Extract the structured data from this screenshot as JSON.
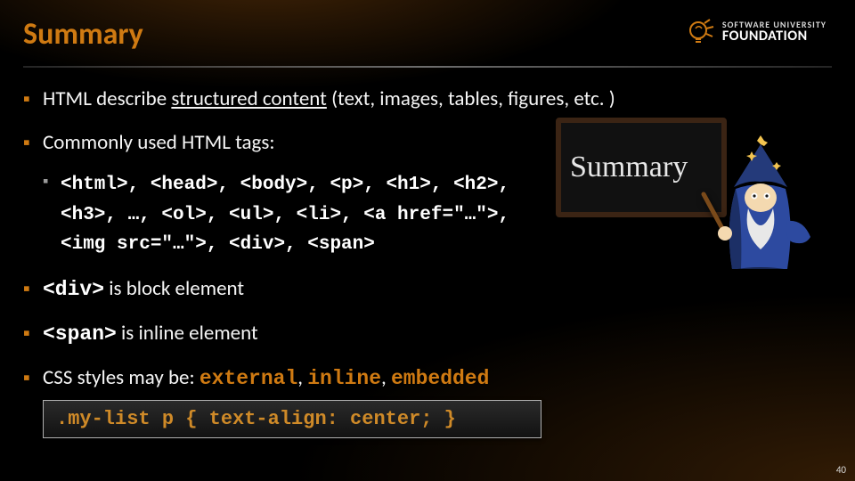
{
  "header": {
    "title": "Summary",
    "logo_line1": "SOFTWARE UNIVERSITY",
    "logo_line2": "FOUNDATION"
  },
  "bullets": {
    "b1_pre": "HTML describe ",
    "b1_u": "structured content",
    "b1_post": " (text, images, tables, figures, etc. )",
    "b2": "Commonly used HTML tags:",
    "b2_tags_line1": "<html>, <head>, <body>, <p>, <h1>, <h2>,",
    "b2_tags_line2": "<h3>, …, <ol>, <ul>, <li>, <a href=\"…\">,",
    "b2_tags_line3": "<img src=\"…\">, <div>, <span>",
    "b3_code": "<div>",
    "b3_post": " is block element",
    "b4_code": "<span>",
    "b4_post": " is inline element",
    "b5_pre": "CSS styles may be: ",
    "b5_k1": "external",
    "b5_sep": ", ",
    "b5_k2": "inline",
    "b5_k3": "embedded"
  },
  "codebox": ".my-list p { text-align: center; }",
  "wizard": {
    "chalk_text": "Summary",
    "chalk_sub": ""
  },
  "page_number": "40"
}
